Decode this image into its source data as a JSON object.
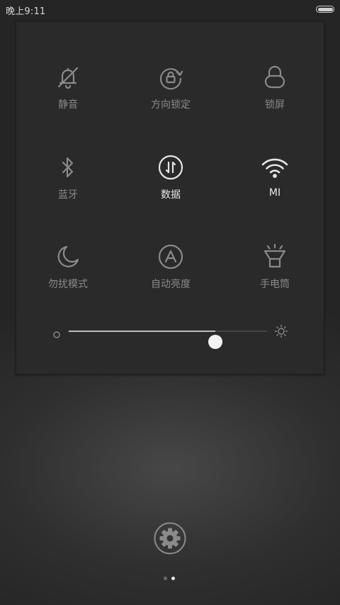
{
  "status_bar": {
    "time": "晚上9:11",
    "battery_icon": "battery-full-icon"
  },
  "quick_settings": {
    "tiles": [
      {
        "label": "静音",
        "icon": "bell-off-icon",
        "active": false
      },
      {
        "label": "方向锁定",
        "icon": "rotation-lock-icon",
        "active": false
      },
      {
        "label": "锁屏",
        "icon": "lock-icon",
        "active": false
      },
      {
        "label": "蓝牙",
        "icon": "bluetooth-icon",
        "active": false
      },
      {
        "label": "数据",
        "icon": "mobile-data-icon",
        "active": true
      },
      {
        "label": "MI",
        "icon": "wifi-icon",
        "active": true
      },
      {
        "label": "勿扰模式",
        "icon": "moon-icon",
        "active": false
      },
      {
        "label": "自动亮度",
        "icon": "auto-brightness-icon",
        "active": false
      },
      {
        "label": "手电筒",
        "icon": "flashlight-icon",
        "active": false
      }
    ],
    "brightness": {
      "level": 0.74,
      "low_icon": "brightness-low-icon",
      "high_icon": "brightness-high-icon"
    }
  },
  "settings_icon": "gear-icon",
  "pager": {
    "count": 2,
    "current": 2
  },
  "colors": {
    "inactive": "#8a8a8a",
    "active": "#e6e6e6",
    "panel": "#2a2a2a"
  }
}
